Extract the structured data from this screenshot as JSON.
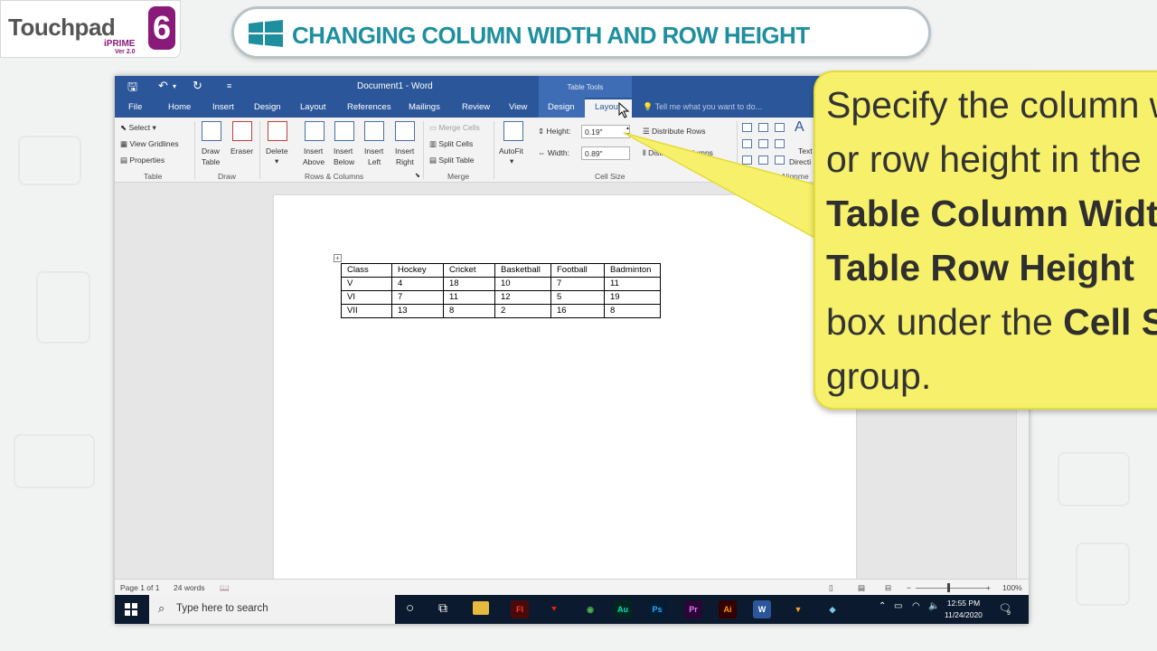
{
  "brand": {
    "name": "Touchpad",
    "sub": "iPRIME",
    "version": "Ver 2.0",
    "number": "6"
  },
  "heading": {
    "title": "CHANGING COLUMN WIDTH AND ROW HEIGHT"
  },
  "window": {
    "title": "Document1 - Word",
    "context_group": "Table Tools",
    "tabs": [
      "File",
      "Home",
      "Insert",
      "Design",
      "Layout",
      "References",
      "Mailings",
      "Review",
      "View",
      "Design",
      "Layout"
    ],
    "active_tab": "Layout",
    "tell_me": "Tell me what you want to do..."
  },
  "ribbon": {
    "table": {
      "select": "Select",
      "view_gridlines": "View Gridlines",
      "properties": "Properties",
      "label": "Table"
    },
    "draw": {
      "draw_table_1": "Draw",
      "draw_table_2": "Table",
      "eraser": "Eraser",
      "label": "Draw"
    },
    "rows_cols": {
      "delete": "Delete",
      "insert_above_1": "Insert",
      "insert_above_2": "Above",
      "insert_below_1": "Insert",
      "insert_below_2": "Below",
      "insert_left_1": "Insert",
      "insert_left_2": "Left",
      "insert_right_1": "Insert",
      "insert_right_2": "Right",
      "label": "Rows & Columns"
    },
    "merge": {
      "merge_cells": "Merge Cells",
      "split_cells": "Split Cells",
      "split_table": "Split Table",
      "label": "Merge"
    },
    "cell_size": {
      "autofit": "AutoFit",
      "height_label": "Height:",
      "height_value": "0.19\"",
      "width_label": "Width:",
      "width_value": "0.89\"",
      "distribute_rows": "Distribute Rows",
      "distribute_columns": "Distribute Columns",
      "label": "Cell Size"
    },
    "alignment": {
      "text_direction_1": "Text",
      "text_direction_2": "Directi",
      "label": "Alignme"
    }
  },
  "table": {
    "rows": [
      [
        "Class",
        "Hockey",
        "Cricket",
        "Basketball",
        "Football",
        "Badminton"
      ],
      [
        "V",
        "4",
        "18",
        "10",
        "7",
        "11"
      ],
      [
        "VI",
        "7",
        "11",
        "12",
        "5",
        "19"
      ],
      [
        "VII",
        "13",
        "8",
        "2",
        "16",
        "8"
      ]
    ]
  },
  "status": {
    "page": "Page 1 of 1",
    "words": "24 words",
    "zoom": "100%"
  },
  "taskbar": {
    "search_placeholder": "Type here to search",
    "time": "12:55 PM",
    "date": "11/24/2020",
    "notifications": "9",
    "apps": [
      {
        "name": "flash-icon",
        "label": "Fl",
        "bg": "#4b0a0a",
        "fg": "#ff3b30"
      },
      {
        "name": "acrobat-icon",
        "label": "⯆",
        "bg": "#0b1a2f",
        "fg": "#e2231a"
      },
      {
        "name": "chrome-icon",
        "label": "◉",
        "bg": "#0b1a2f",
        "fg": "#4caf50"
      },
      {
        "name": "audition-icon",
        "label": "Au",
        "bg": "#00261f",
        "fg": "#00e4bb"
      },
      {
        "name": "photoshop-icon",
        "label": "Ps",
        "bg": "#001d34",
        "fg": "#31a8ff"
      },
      {
        "name": "premiere-icon",
        "label": "Pr",
        "bg": "#2a0634",
        "fg": "#e77bff"
      },
      {
        "name": "illustrator-icon",
        "label": "Ai",
        "bg": "#330000",
        "fg": "#ff9a00"
      },
      {
        "name": "word-icon",
        "label": "W",
        "bg": "#2b579a",
        "fg": "#ffffff"
      },
      {
        "name": "vectorian-icon",
        "label": "▼",
        "bg": "#0b1a2f",
        "fg": "#f4a21d"
      },
      {
        "name": "sketch-icon",
        "label": "◆",
        "bg": "#0b1a2f",
        "fg": "#7ec8e3"
      }
    ]
  },
  "callout": {
    "line1": "Specify the column w",
    "line2": "or row height in the",
    "bold1": "Table Column Widt",
    "bold2": "Table Row Height",
    "line5a": "box under the ",
    "bold3": "Cell S",
    "line6": "group."
  },
  "colors": {
    "word_blue": "#2b579a",
    "heading_teal": "#1f8fa0",
    "callout_yellow": "#f7f06a",
    "brand_purple": "#8a1a7a"
  }
}
